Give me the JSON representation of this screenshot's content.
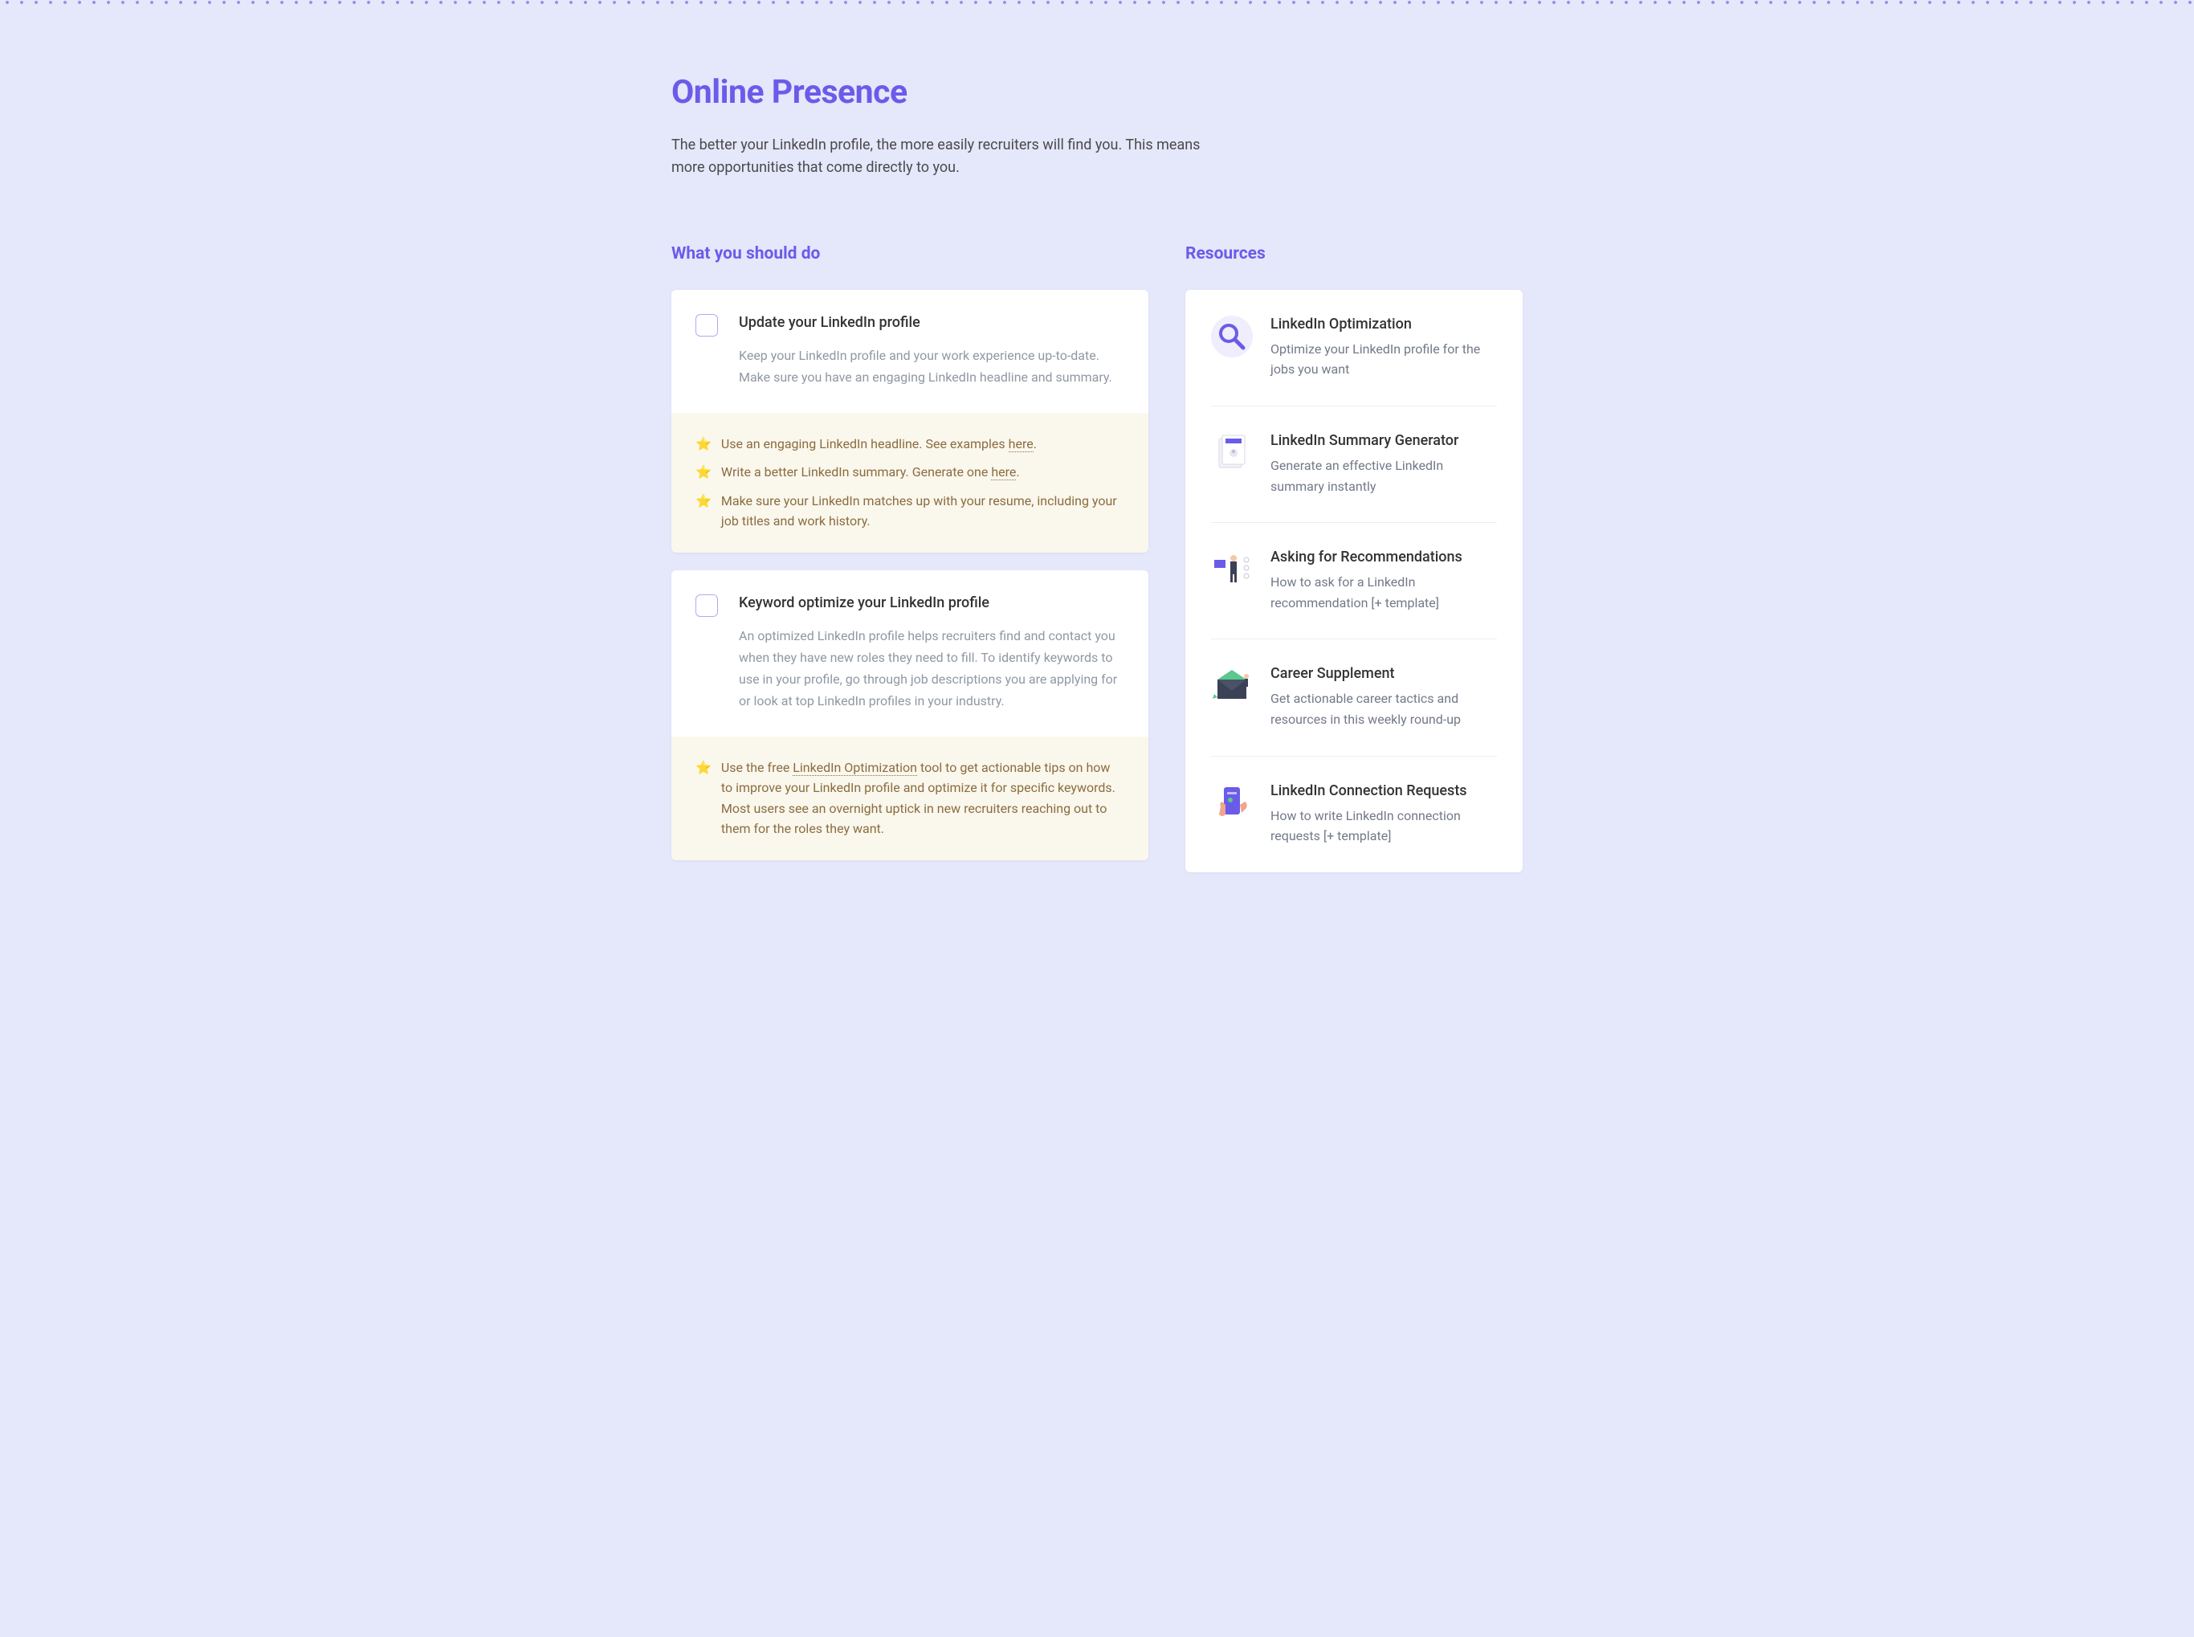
{
  "page": {
    "title": "Online Presence",
    "subtitle": "The better your LinkedIn profile, the more easily recruiters will find you. This means more opportunities that come directly to you."
  },
  "todo": {
    "heading": "What you should do",
    "tasks": [
      {
        "title": "Update your LinkedIn profile",
        "desc": "Keep your LinkedIn profile and your work experience up-to-date. Make sure you have an engaging LinkedIn headline and summary.",
        "tips": [
          {
            "prefix": "Use an engaging LinkedIn headline. See examples ",
            "link": "here",
            "suffix": "."
          },
          {
            "prefix": "Write a better LinkedIn summary. Generate one ",
            "link": "here",
            "suffix": "."
          },
          {
            "prefix": "Make sure your LinkedIn matches up with your resume, including your job titles and work history.",
            "link": "",
            "suffix": ""
          }
        ]
      },
      {
        "title": "Keyword optimize your LinkedIn profile",
        "desc": "An optimized LinkedIn profile helps recruiters find and contact you when they have new roles they need to fill. To identify keywords to use in your profile, go through job descriptions you are applying for or look at top LinkedIn profiles in your industry.",
        "tips": [
          {
            "prefix": "Use the free ",
            "link": "LinkedIn Optimization",
            "suffix": " tool to get actionable tips on how to improve your LinkedIn profile and optimize it for specific keywords. Most users see an overnight uptick in new recruiters reaching out to them for the roles they want."
          }
        ]
      }
    ]
  },
  "resources": {
    "heading": "Resources",
    "items": [
      {
        "title": "LinkedIn Optimization",
        "desc": "Optimize your LinkedIn profile for the jobs you want"
      },
      {
        "title": "LinkedIn Summary Generator",
        "desc": "Generate an effective LinkedIn summary instantly"
      },
      {
        "title": "Asking for Recommendations",
        "desc": "How to ask for a LinkedIn recommendation [+ template]"
      },
      {
        "title": "Career Supplement",
        "desc": "Get actionable career tactics and resources in this weekly round-up"
      },
      {
        "title": "LinkedIn Connection Requests",
        "desc": "How to write LinkedIn connection requests [+ template]"
      }
    ]
  },
  "icons": {
    "star": "⭐"
  }
}
